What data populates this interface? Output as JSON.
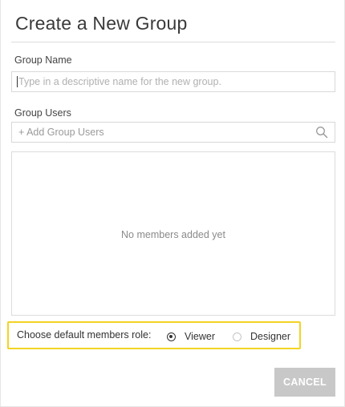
{
  "dialog": {
    "title": "Create a New Group"
  },
  "group_name": {
    "label": "Group Name",
    "value": "",
    "placeholder": "Type in a descriptive name for the new group."
  },
  "group_users": {
    "label": "Group Users",
    "search_placeholder": "+ Add Group Users",
    "search_icon": "search-icon",
    "empty_message": "No members added yet"
  },
  "role": {
    "label": "Choose default members role:",
    "options": [
      {
        "label": "Viewer",
        "selected": true
      },
      {
        "label": "Designer",
        "selected": false
      }
    ],
    "highlight_color": "#f2d422"
  },
  "actions": {
    "cancel_label": "CANCEL"
  },
  "colors": {
    "button_disabled": "#c8c8c8",
    "border": "#d8d8d8"
  }
}
